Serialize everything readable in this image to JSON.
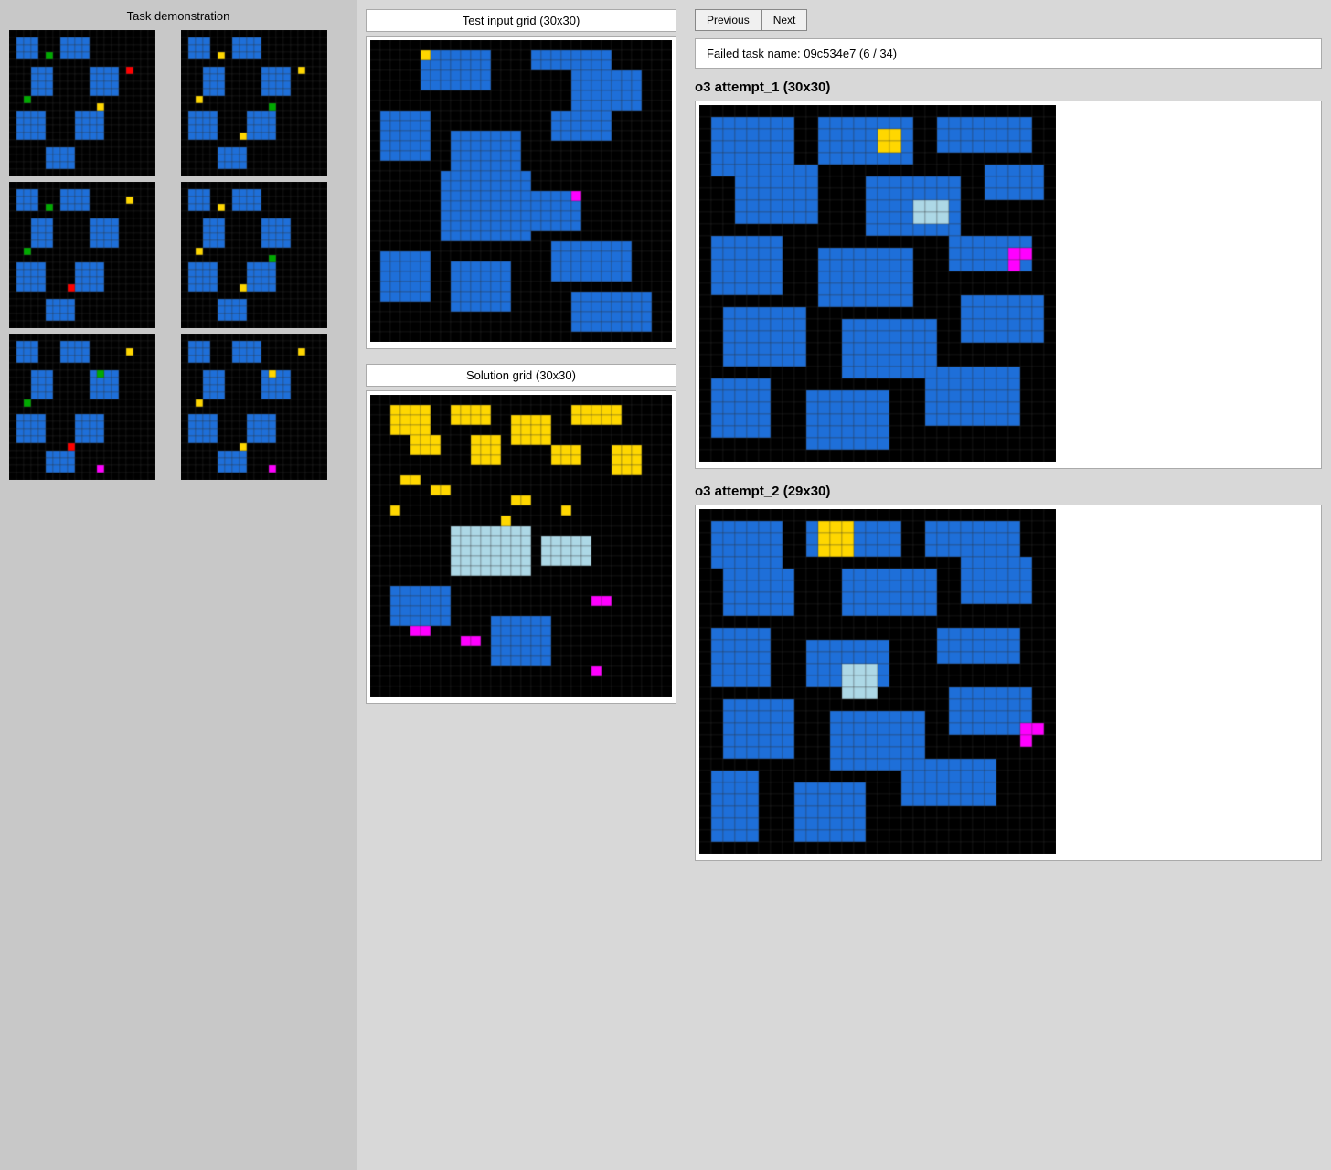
{
  "left_panel": {
    "title": "Task demonstration"
  },
  "middle_panel": {
    "test_input_title": "Test input grid (30x30)",
    "solution_title": "Solution grid (30x30)"
  },
  "right_panel": {
    "prev_label": "Previous",
    "next_label": "Next",
    "task_info": "Failed task name: 09c534e7 (6 / 34)",
    "attempt1_title": "o3 attempt_1 (30x30)",
    "attempt2_title": "o3 attempt_2 (29x30)"
  },
  "colors": {
    "black": "#000000",
    "blue": "#1E6FD9",
    "yellow": "#FFFF00",
    "red": "#FF0000",
    "green": "#00AA00",
    "magenta": "#FF00FF",
    "light_blue": "#ADD8E6",
    "orange": "#FF8C00"
  }
}
